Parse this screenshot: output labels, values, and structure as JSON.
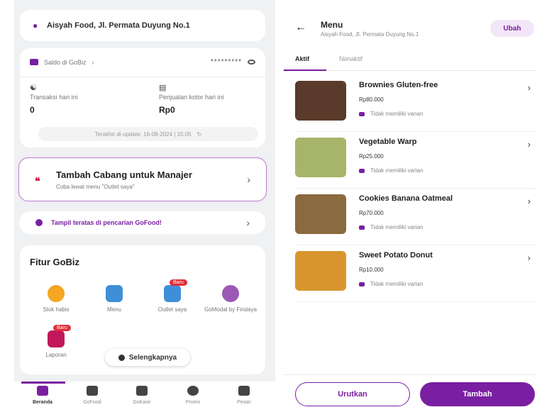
{
  "left": {
    "location": "Aisyah Food, Jl. Permata Duyung No.1",
    "saldo": {
      "label": "Saldo di GoBiz",
      "masked": "*********"
    },
    "stats": [
      {
        "label": "Transaksi hari ini",
        "value": "0"
      },
      {
        "label": "Penjualan kotor hari ini",
        "value": "Rp0"
      }
    ],
    "updated": "Terakhir di-update: 16-08-2024 | 15:05",
    "cabang": {
      "title": "Tambah Cabang untuk Manajer",
      "subtitle": "Coba lewat menu \"Outlet saya\""
    },
    "tampil": "Tampil teratas di pencarian GoFood!",
    "fitur": {
      "title": "Fitur GoBiz",
      "items": [
        {
          "label": "Stok habis",
          "badge": ""
        },
        {
          "label": "Menu",
          "badge": ""
        },
        {
          "label": "Outlet saya",
          "badge": "Baru"
        },
        {
          "label": "GoModal by Findaya",
          "badge": ""
        },
        {
          "label": "Laporan",
          "badge": "Baru"
        }
      ],
      "more": "Selengkapnya"
    },
    "nav": [
      "Beranda",
      "GoFood",
      "GoKasir",
      "Promo",
      "Pesan"
    ]
  },
  "right": {
    "title": "Menu",
    "subtitle": "Aisyah Food, Jl. Permata Duyung No.1",
    "edit": "Ubah",
    "tabs": [
      "Aktif",
      "Nonaktif"
    ],
    "items": [
      {
        "name": "Brownies Gluten-free",
        "price": "Rp80.000",
        "variant": "Tidak memiliki varian"
      },
      {
        "name": "Vegetable Warp",
        "price": "Rp25.000",
        "variant": "Tidak memiliki varian"
      },
      {
        "name": "Cookies Banana Oatmeal",
        "price": "Rp70.000",
        "variant": "Tidak memiliki varian"
      },
      {
        "name": "Sweet Potato Donut",
        "price": "Rp10.000",
        "variant": "Tidak memiliki varian"
      }
    ],
    "buttons": {
      "sort": "Urutkan",
      "add": "Tambah"
    }
  },
  "colors": {
    "primary": "#7a1fa2",
    "accent_red": "#e02e3b"
  }
}
